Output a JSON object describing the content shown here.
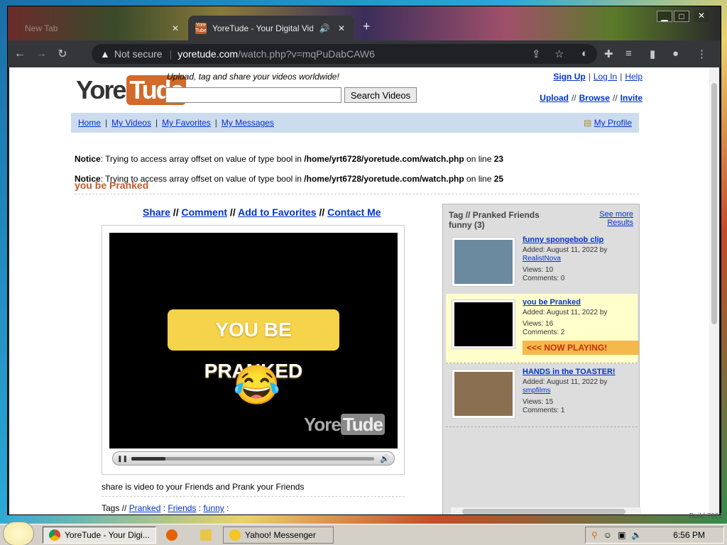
{
  "browser": {
    "tabs": [
      {
        "title": "New Tab"
      },
      {
        "title": "YoreTude - Your Digital Vide",
        "active": true
      }
    ],
    "address": {
      "security": "Not secure",
      "host": "yoretude.com",
      "path": "/watch.php?v=mqPuDabCAW6"
    }
  },
  "site": {
    "logo": {
      "part1": "Yore",
      "part2": "Tude"
    },
    "tagline": "Upload, tag and share your videos worldwide!",
    "search": {
      "value": "",
      "button": "Search Videos"
    },
    "top_links": [
      "Sign Up",
      "Log In",
      "Help"
    ],
    "top_links2": [
      "Upload",
      "Browse",
      "Invite"
    ],
    "nav": [
      "Home",
      "My Videos",
      "My Favorites",
      "My Messages"
    ],
    "my_profile": "My Profile"
  },
  "notices": [
    {
      "label": "Notice",
      "text": ": Trying to access array offset on value of type bool in ",
      "path": "/home/yrt6728/yoretude.com/watch.php",
      "on": " on line ",
      "line": "23"
    },
    {
      "label": "Notice",
      "text": ": Trying to access array offset on value of type bool in ",
      "path": "/home/yrt6728/yoretude.com/watch.php",
      "on": " on line ",
      "line": "25"
    }
  ],
  "video": {
    "title": "you be Pranked",
    "actions": [
      "Share",
      "Comment",
      "Add to Favorites",
      "Contact Me"
    ],
    "banner": "YOU BE PRANKED",
    "emoji": "😂",
    "watermark": {
      "part1": "Yore",
      "part2": "Tude"
    },
    "progress": 0.14,
    "description": "share is video to your Friends and Prank your Friends",
    "tags_label": "Tags //",
    "tags": [
      "Pranked",
      "Friends",
      "funny"
    ]
  },
  "related": {
    "heading": "Tag // Pranked Friends funny (3)",
    "see_more": "See more",
    "results": "Results",
    "items": [
      {
        "title": "funny spongebob clip",
        "added": "Added: August 11, 2022 by",
        "user": "RealistNova",
        "views": "Views: 10",
        "comments": "Comments: 0",
        "color": "#6b8aa0"
      },
      {
        "title": "you be Pranked",
        "added": "Added: August 11, 2022 by",
        "user": "",
        "views": "Views: 16",
        "comments": "Comments: 2",
        "now_playing": "<<< NOW PLAYING!",
        "color": "#000000"
      },
      {
        "title": "HANDS in the TOASTER!",
        "added": "Added: August 11, 2022 by",
        "user": "smpfilms",
        "views": "Views: 15",
        "comments": "Comments: 1",
        "color": "#8a7050"
      }
    ]
  },
  "taskbar": {
    "items": [
      "YoreTude - Your Digi...",
      "Yahoo! Messenger"
    ],
    "clock": "6:56 PM",
    "build": "Build 7001"
  },
  "colors": {
    "link": "#0033cc",
    "accent": "#d16a2a",
    "navbar": "#ccdcef"
  }
}
